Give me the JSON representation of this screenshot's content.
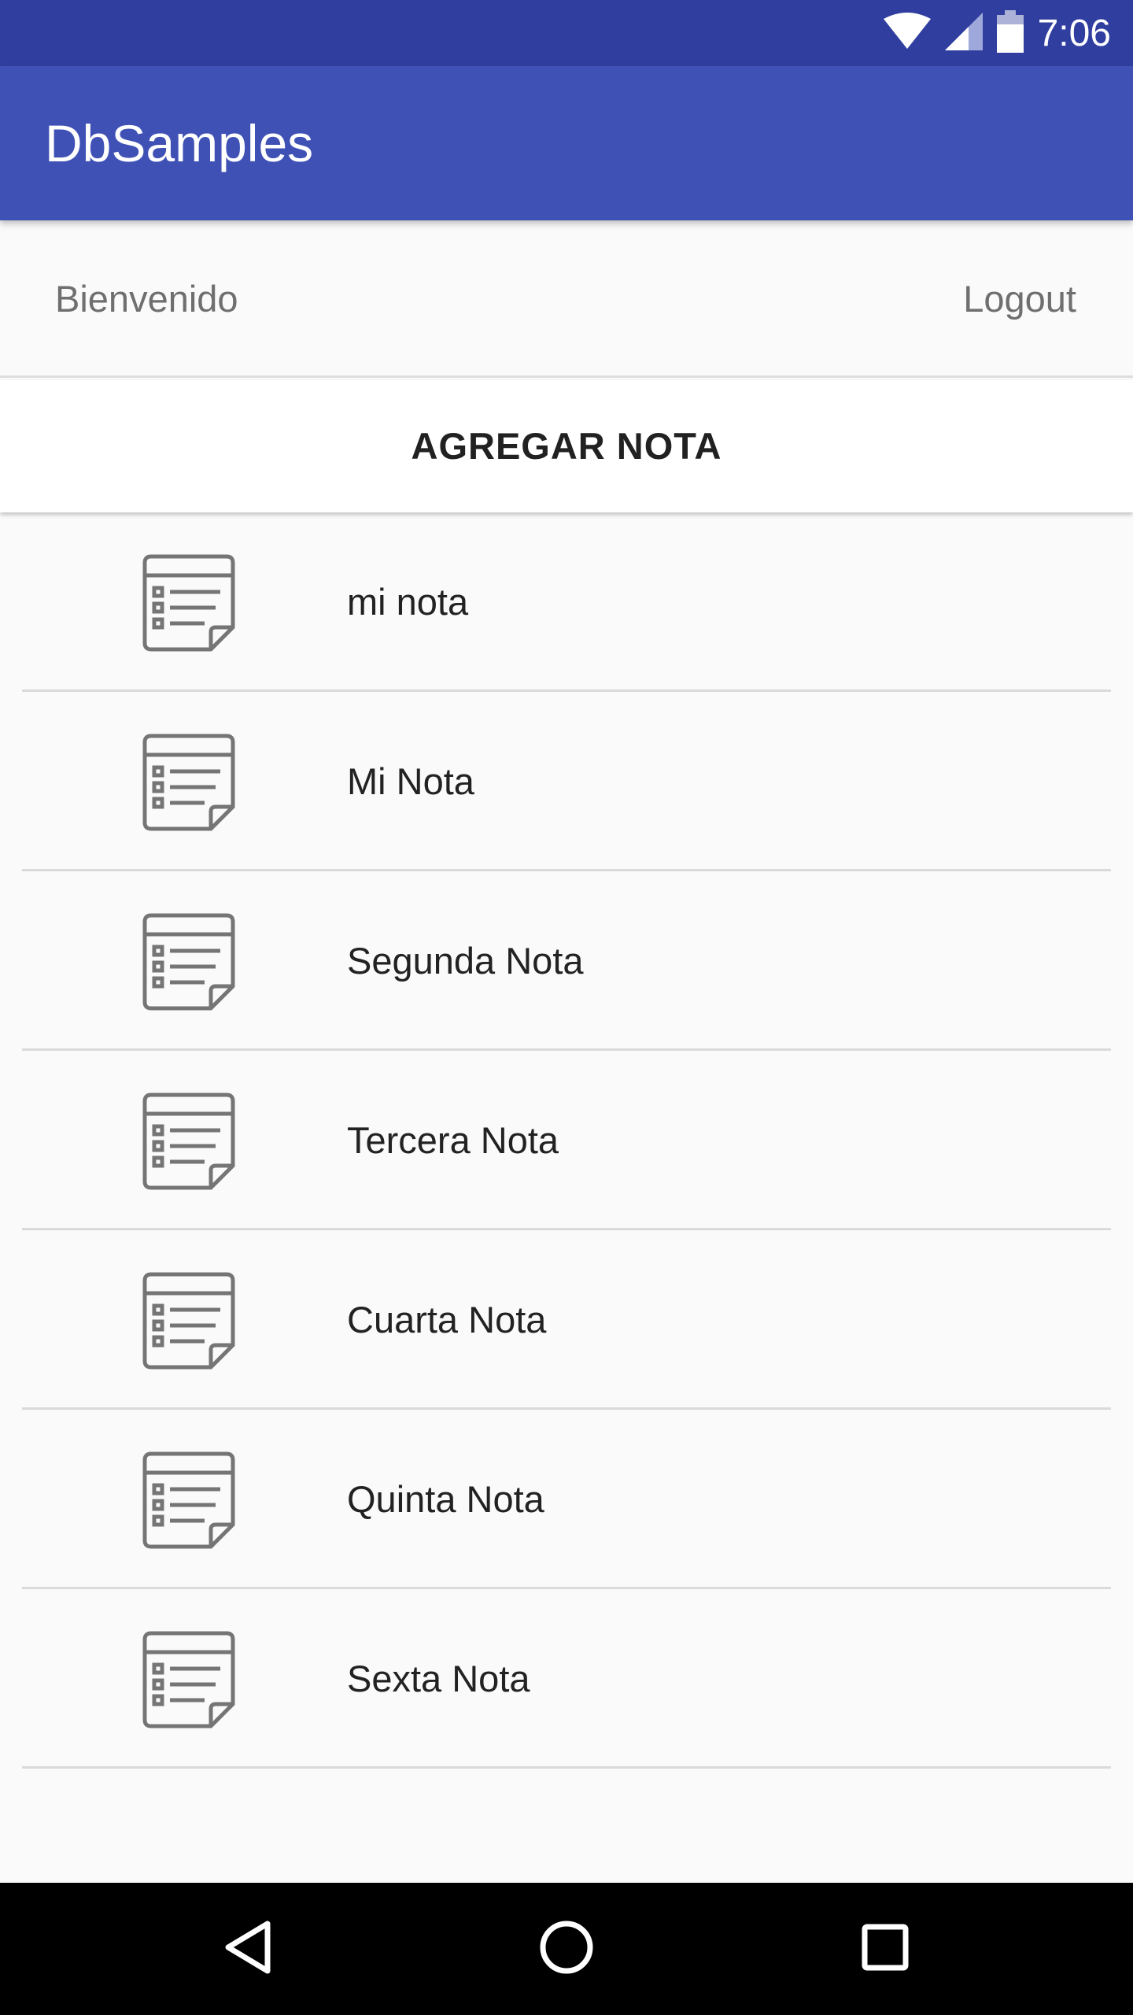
{
  "status_bar": {
    "time": "7:06",
    "icons": [
      "wifi-icon",
      "cell-signal-icon",
      "battery-icon"
    ],
    "color": "#303f9f"
  },
  "app_bar": {
    "title": "DbSamples",
    "color": "#3f51b5"
  },
  "welcome": {
    "greeting": "Bienvenido",
    "logout_label": "Logout"
  },
  "actions": {
    "add_note_label": "AGREGAR NOTA"
  },
  "notes": [
    {
      "title": "mi nota",
      "icon": "note-icon"
    },
    {
      "title": "Mi Nota",
      "icon": "note-icon"
    },
    {
      "title": "Segunda Nota",
      "icon": "note-icon"
    },
    {
      "title": "Tercera Nota",
      "icon": "note-icon"
    },
    {
      "title": "Cuarta Nota",
      "icon": "note-icon"
    },
    {
      "title": "Quinta Nota",
      "icon": "note-icon"
    },
    {
      "title": "Sexta Nota",
      "icon": "note-icon"
    }
  ],
  "nav_bar": {
    "buttons": [
      "back-icon",
      "home-icon",
      "recents-icon"
    ]
  }
}
